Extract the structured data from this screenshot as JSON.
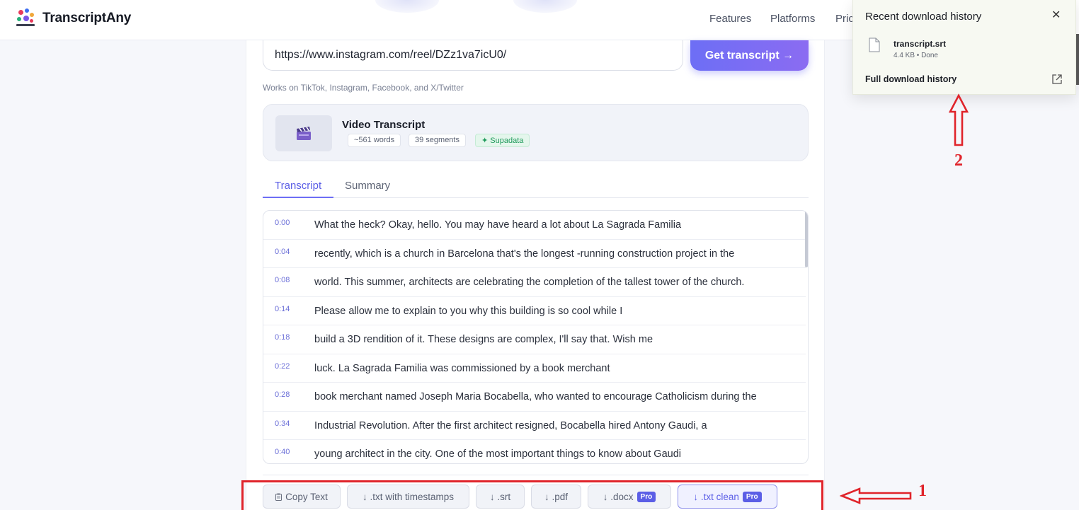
{
  "app": {
    "name": "TranscriptAny"
  },
  "nav": {
    "links": [
      "Features",
      "Platforms",
      "Pric"
    ]
  },
  "form": {
    "url_value": "https://www.instagram.com/reel/DZz1va7icU0/",
    "get_button": "Get transcript →",
    "works_on": "Works on TikTok, Instagram, Facebook, and X/Twitter"
  },
  "video": {
    "title": "Video Transcript",
    "words": "~561 words",
    "segments": "39 segments",
    "provider": "✦ Supadata",
    "thumbnail_icon": "clapperboard-icon"
  },
  "tabs": [
    {
      "label": "Transcript",
      "active": true
    },
    {
      "label": "Summary",
      "active": false
    }
  ],
  "transcript": [
    {
      "time": "0:00",
      "text": "What the heck? Okay, hello. You may have heard a lot about La Sagrada Familia"
    },
    {
      "time": "0:04",
      "text": "recently, which is a church in Barcelona that's the longest -running construction project in the"
    },
    {
      "time": "0:08",
      "text": "world. This summer, architects are celebrating the completion of the tallest tower of the church."
    },
    {
      "time": "0:14",
      "text": "Please allow me to explain to you why this building is so cool while I"
    },
    {
      "time": "0:18",
      "text": "build a 3D rendition of it. These designs are complex, I'll say that. Wish me"
    },
    {
      "time": "0:22",
      "text": "luck. La Sagrada Familia was commissioned by a book merchant"
    },
    {
      "time": "0:28",
      "text": "book merchant named Joseph Maria Bocabella, who wanted to encourage Catholicism during the"
    },
    {
      "time": "0:34",
      "text": "Industrial Revolution. After the first architect resigned, Bocabella hired Antony Gaudi, a"
    },
    {
      "time": "0:40",
      "text": "young architect in the city. One of the most important things to know about Gaudi"
    }
  ],
  "downloads": {
    "copy_text": "Copy Text",
    "txt_timestamps": "↓ .txt with timestamps",
    "srt": "↓ .srt",
    "pdf": "↓ .pdf",
    "docx": "↓ .docx",
    "txt_clean": "↓ .txt clean",
    "pro_badge": "Pro"
  },
  "download_popup": {
    "title": "Recent download history",
    "file_name": "transcript.srt",
    "file_meta": "4.4 KB • Done",
    "full_history": "Full download history"
  },
  "annotations": {
    "label_1": "1",
    "label_2": "2",
    "color": "#e0242b"
  },
  "colors": {
    "accent": "#6d6ef5",
    "annotation": "#e0242b"
  }
}
